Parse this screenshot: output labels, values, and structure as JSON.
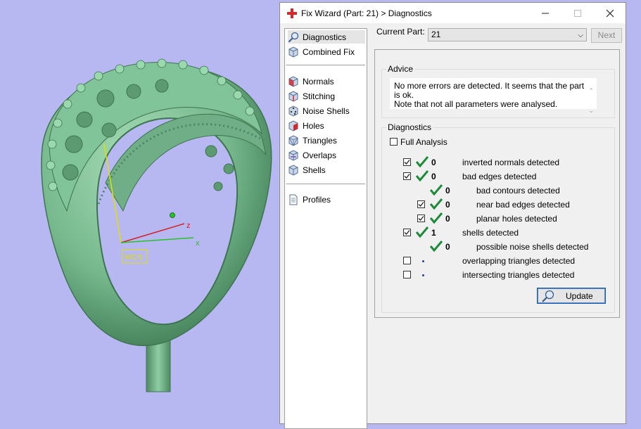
{
  "viewport": {
    "wcs_label": "WCS",
    "axis_x": "x",
    "axis_z": "z",
    "colors": {
      "background": "#b7b7f1",
      "part": "#7cbf93",
      "axis_x": "#26c226",
      "axis_y": "#e0e000",
      "axis_z": "#d22020"
    }
  },
  "dialog": {
    "title": "Fix Wizard (Part: 21) > Diagnostics",
    "app_icon": "red-cross-icon"
  },
  "nav": {
    "items": [
      {
        "label": "Diagnostics",
        "icon": "magnifier-icon",
        "selected": true
      },
      {
        "label": "Combined Fix",
        "icon": "cube-icon"
      },
      {
        "label": "Normals",
        "icon": "cube-normals-icon"
      },
      {
        "label": "Stitching",
        "icon": "cube-stitch-icon"
      },
      {
        "label": "Noise Shells",
        "icon": "cube-noise-icon"
      },
      {
        "label": "Holes",
        "icon": "cube-hole-icon"
      },
      {
        "label": "Triangles",
        "icon": "cube-triangles-icon"
      },
      {
        "label": "Overlaps",
        "icon": "cube-overlap-icon"
      },
      {
        "label": "Shells",
        "icon": "cube-shells-icon"
      },
      {
        "label": "Profiles",
        "icon": "document-icon"
      }
    ]
  },
  "toolbar": {
    "current_part_label": "Current Part:",
    "current_part_value": "21",
    "next_label": "Next"
  },
  "advice": {
    "legend": "Advice",
    "line1": "No more errors are detected. It seems that the part is ok.",
    "line2": "Note that not all parameters were analysed."
  },
  "diagnostics": {
    "legend": "Diagnostics",
    "full_analysis_label": "Full Analysis",
    "full_analysis_checked": false,
    "rows": [
      {
        "checkbox": true,
        "checked": true,
        "status": "ok",
        "count": "0",
        "label": "inverted normals detected",
        "indent": 0
      },
      {
        "checkbox": true,
        "checked": true,
        "status": "ok",
        "count": "0",
        "label": "bad edges detected",
        "indent": 0
      },
      {
        "checkbox": false,
        "checked": false,
        "status": "ok",
        "count": "0",
        "label": "bad contours detected",
        "indent": 1
      },
      {
        "checkbox": true,
        "checked": true,
        "status": "ok",
        "count": "0",
        "label": "near bad edges detected",
        "indent": 1
      },
      {
        "checkbox": true,
        "checked": true,
        "status": "ok",
        "count": "0",
        "label": "planar holes detected",
        "indent": 1
      },
      {
        "checkbox": true,
        "checked": true,
        "status": "ok",
        "count": "1",
        "label": "shells detected",
        "indent": 0
      },
      {
        "checkbox": false,
        "checked": false,
        "status": "ok",
        "count": "0",
        "label": "possible noise shells detected",
        "indent": 1
      },
      {
        "checkbox": true,
        "checked": false,
        "status": "none",
        "count": "",
        "label": "overlapping triangles detected",
        "indent": 0
      },
      {
        "checkbox": true,
        "checked": false,
        "status": "none",
        "count": "",
        "label": "intersecting triangles detected",
        "indent": 0
      }
    ],
    "update_label": "Update"
  }
}
